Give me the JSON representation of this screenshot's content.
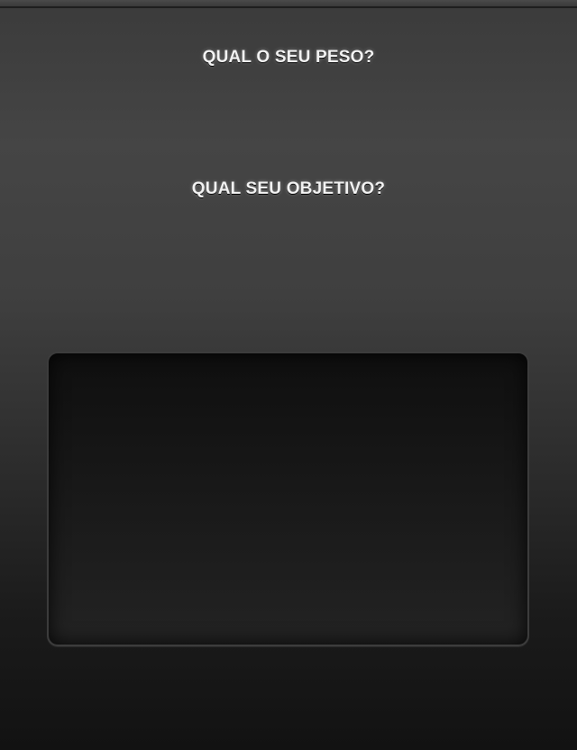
{
  "form": {
    "weight_question": "QUAL O SEU PESO?",
    "goal_question": "QUAL SEU OBJETIVO?"
  },
  "colors": {
    "text": "#f2f2f2",
    "background_top": "#454545",
    "background_bottom": "#121212",
    "panel_background": "#151515",
    "panel_border": "#3c3c3c"
  }
}
